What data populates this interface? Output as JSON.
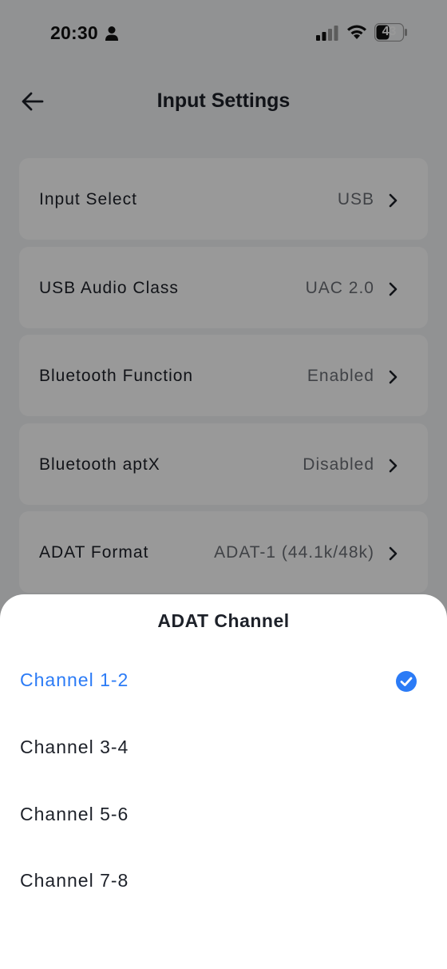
{
  "status_bar": {
    "time": "20:30",
    "battery": "43",
    "icons": [
      "person-icon",
      "signal-icon",
      "wifi-icon",
      "battery-icon"
    ]
  },
  "nav": {
    "title": "Input Settings",
    "back_icon": "back-arrow-icon"
  },
  "settings": [
    {
      "label": "Input Select",
      "value": "USB"
    },
    {
      "label": "USB Audio Class",
      "value": "UAC 2.0"
    },
    {
      "label": "Bluetooth Function",
      "value": "Enabled"
    },
    {
      "label": "Bluetooth aptX",
      "value": "Disabled"
    },
    {
      "label": "ADAT Format",
      "value": "ADAT-1 (44.1k/48k)"
    }
  ],
  "sheet": {
    "title": "ADAT Channel",
    "options": [
      {
        "label": "Channel 1-2",
        "selected": true
      },
      {
        "label": "Channel 3-4",
        "selected": false
      },
      {
        "label": "Channel 5-6",
        "selected": false
      },
      {
        "label": "Channel 7-8",
        "selected": false
      }
    ]
  },
  "colors": {
    "accent": "#2b7bf6",
    "background": "#f2f3f5",
    "overlay": "rgba(0,0,0,0.4)"
  }
}
